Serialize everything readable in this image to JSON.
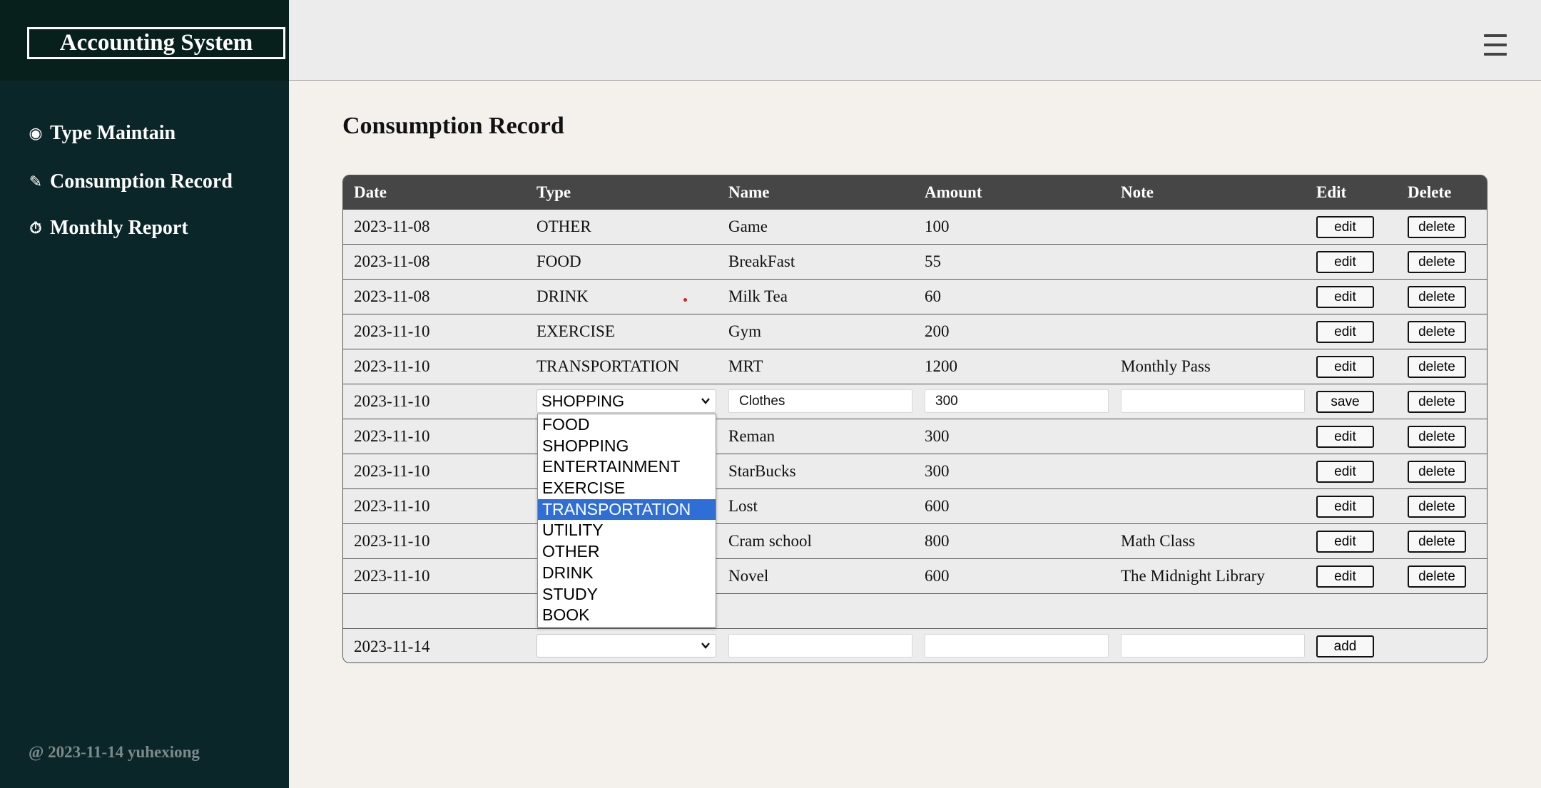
{
  "app": {
    "brand": "Accounting System",
    "footer": "@ 2023-11-14 yuhexiong"
  },
  "sidebar": {
    "items": [
      {
        "icon": "◉",
        "icon_name": "radio-circle-icon",
        "label": "Type Maintain"
      },
      {
        "icon": "✎",
        "icon_name": "pencil-icon",
        "label": "Consumption Record"
      },
      {
        "icon": "⏱",
        "icon_name": "stopwatch-icon",
        "label": "Monthly Report"
      }
    ]
  },
  "header": {
    "menu_icon": "hamburger-menu-icon"
  },
  "page": {
    "title": "Consumption Record"
  },
  "table": {
    "columns": [
      "Date",
      "Type",
      "Name",
      "Amount",
      "Note",
      "Edit",
      "Delete"
    ],
    "rows": [
      {
        "date": "2023-11-08",
        "type": "OTHER",
        "name": "Game",
        "amount": "100",
        "note": "",
        "edit": "edit",
        "delete": "delete"
      },
      {
        "date": "2023-11-08",
        "type": "FOOD",
        "name": "BreakFast",
        "amount": "55",
        "note": "",
        "edit": "edit",
        "delete": "delete"
      },
      {
        "date": "2023-11-08",
        "type": "DRINK",
        "name": "Milk Tea",
        "amount": "60",
        "note": "",
        "edit": "edit",
        "delete": "delete"
      },
      {
        "date": "2023-11-10",
        "type": "EXERCISE",
        "name": "Gym",
        "amount": "200",
        "note": "",
        "edit": "edit",
        "delete": "delete"
      },
      {
        "date": "2023-11-10",
        "type": "TRANSPORTATION",
        "name": "MRT",
        "amount": "1200",
        "note": "Monthly Pass",
        "edit": "edit",
        "delete": "delete"
      },
      {
        "date": "2023-11-10",
        "type": "",
        "name": "Reman",
        "amount": "300",
        "note": "",
        "edit": "edit",
        "delete": "delete"
      },
      {
        "date": "2023-11-10",
        "type": "",
        "name": "StarBucks",
        "amount": "300",
        "note": "",
        "edit": "edit",
        "delete": "delete"
      },
      {
        "date": "2023-11-10",
        "type": "",
        "name": "Lost",
        "amount": "600",
        "note": "",
        "edit": "edit",
        "delete": "delete"
      },
      {
        "date": "2023-11-10",
        "type": "",
        "name": "Cram school",
        "amount": "800",
        "note": "Math Class",
        "edit": "edit",
        "delete": "delete"
      },
      {
        "date": "2023-11-10",
        "type": "",
        "name": "Novel",
        "amount": "600",
        "note": "The Midnight Library",
        "edit": "edit",
        "delete": "delete"
      }
    ],
    "editing_row": {
      "date": "2023-11-10",
      "type_selected": "SHOPPING",
      "name": "Clothes",
      "amount": "300",
      "note": "",
      "save": "save",
      "delete": "delete"
    },
    "add_row": {
      "date": "2023-11-14",
      "type_selected": "",
      "name": "",
      "amount": "",
      "note": "",
      "add": "add"
    }
  },
  "type_dropdown": {
    "options": [
      "FOOD",
      "SHOPPING",
      "ENTERTAINMENT",
      "EXERCISE",
      "TRANSPORTATION",
      "UTILITY",
      "OTHER",
      "DRINK",
      "STUDY",
      "BOOK"
    ],
    "highlighted": "TRANSPORTATION"
  },
  "colors": {
    "sidebar": "#0a2629",
    "brand_bar": "#08201b",
    "header": "#ececec",
    "table_header": "#464646",
    "highlight": "#2f6ed6",
    "content_bg": "#f4f1ed"
  }
}
